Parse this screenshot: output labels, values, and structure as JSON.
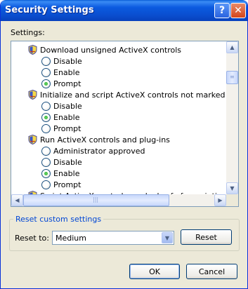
{
  "window": {
    "title": "Security Settings",
    "help_glyph": "?",
    "close_glyph": "✕"
  },
  "settings": {
    "label": "Settings:",
    "rows": [
      {
        "kind": "header",
        "text": "Download unsigned ActiveX controls"
      },
      {
        "kind": "option",
        "text": "Disable",
        "selected": false
      },
      {
        "kind": "option",
        "text": "Enable",
        "selected": false
      },
      {
        "kind": "option",
        "text": "Prompt",
        "selected": true
      },
      {
        "kind": "header",
        "text": "Initialize and script ActiveX controls not marked as safe"
      },
      {
        "kind": "option",
        "text": "Disable",
        "selected": false
      },
      {
        "kind": "option",
        "text": "Enable",
        "selected": true
      },
      {
        "kind": "option",
        "text": "Prompt",
        "selected": false
      },
      {
        "kind": "header",
        "text": "Run ActiveX controls and plug-ins"
      },
      {
        "kind": "option",
        "text": "Administrator approved",
        "selected": false
      },
      {
        "kind": "option",
        "text": "Disable",
        "selected": false
      },
      {
        "kind": "option",
        "text": "Enable",
        "selected": true
      },
      {
        "kind": "option",
        "text": "Prompt",
        "selected": false
      },
      {
        "kind": "header",
        "text": "Script ActiveX controls marked safe for scripting"
      }
    ]
  },
  "reset": {
    "group_title": "Reset custom settings",
    "reset_to_label": "Reset to:",
    "selected_level": "Medium",
    "reset_button": "Reset"
  },
  "footer": {
    "ok": "OK",
    "cancel": "Cancel"
  },
  "colors": {
    "titlebar": "#0a4fd0",
    "dialog_bg": "#ece9d8",
    "group_title": "#0046d5"
  }
}
